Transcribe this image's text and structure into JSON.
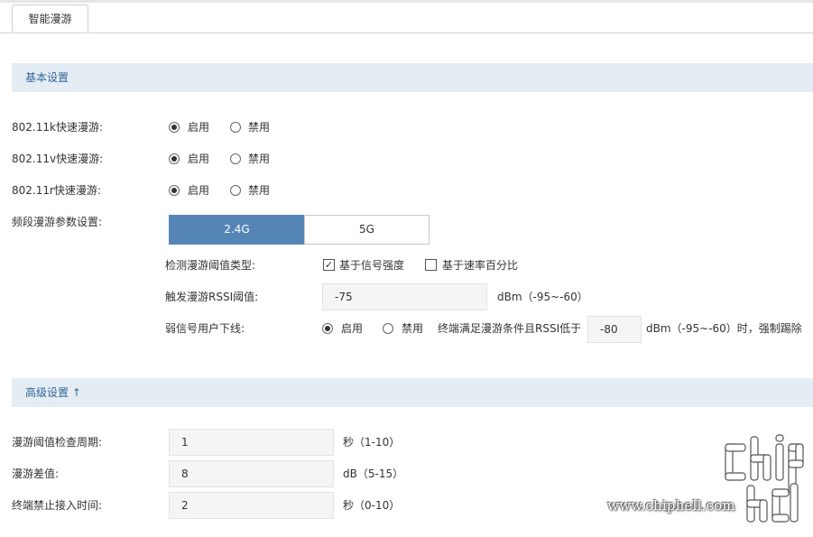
{
  "tab": {
    "label": "智能漫游"
  },
  "basic": {
    "title": "基本设置",
    "rows": [
      {
        "label": "802.11k快速漫游:",
        "on": "启用",
        "off": "禁用",
        "selected": "on"
      },
      {
        "label": "802.11v快速漫游:",
        "on": "启用",
        "off": "禁用",
        "selected": "on"
      },
      {
        "label": "802.11r快速漫游:",
        "on": "启用",
        "off": "禁用",
        "selected": "on"
      }
    ],
    "band": {
      "label": "频段漫游参数设置:",
      "options": [
        "2.4G",
        "5G"
      ],
      "selected": "2.4G"
    },
    "detect_type": {
      "label": "检测漫游阈值类型:",
      "options": [
        {
          "label": "基于信号强度",
          "checked": true
        },
        {
          "label": "基于速率百分比",
          "checked": false
        }
      ]
    },
    "rssi": {
      "label": "触发漫游RSSI阈值:",
      "value": "-75",
      "hint": "dBm（-95~-60）"
    },
    "weak": {
      "label": "弱信号用户下线:",
      "on": "启用",
      "off": "禁用",
      "selected": "on",
      "desc": "终端满足漫游条件且RSSI低于",
      "value": "-80",
      "hint": "dBm（-95~-60）时，强制踢除"
    }
  },
  "advanced": {
    "title": "高级设置 ↑",
    "rows": [
      {
        "label": "漫游阈值检查周期:",
        "value": "1",
        "hint": "秒（1-10）"
      },
      {
        "label": "漫游差值:",
        "value": "8",
        "hint": "dB（5-15）"
      },
      {
        "label": "终端禁止接入时间:",
        "value": "2",
        "hint": "秒（0-10）"
      }
    ]
  },
  "watermark": {
    "text": "www.chiphell.com"
  },
  "colors": {
    "accent": "#5585b5",
    "section_bg": "#e4edf4",
    "section_text": "#336699"
  }
}
